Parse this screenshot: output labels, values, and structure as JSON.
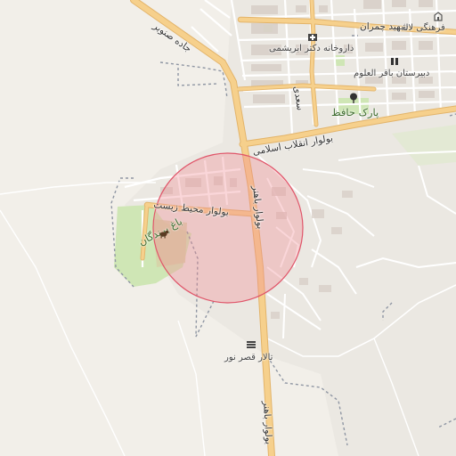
{
  "map": {
    "labels": {
      "jadeh_sanobar": "جاده صنوبر",
      "shahid_chamran": "شهید چمران",
      "farhangi_laleh": "فرهنگی لاله",
      "darukhaneh": "داروخانه دکتر ابریشمی",
      "dabirestan": "دبیرستان باقر العلوم",
      "park_hafez": "پارک حافظ",
      "saadi": "سعدی",
      "bolvar_enghelab": "بولوار انقلاب اسلامی",
      "bolvar_mohit": "بولوار محیط زیست",
      "bolvar_bahonar_1": "بولوار باهنر",
      "bolvar_bahonar_2": "بولوار باهنر",
      "bagh_parandegan": "باغ پرندگان",
      "talar": "تالار قصر نور"
    },
    "colors": {
      "background": "#f2efe9",
      "major_road": "#f6d08c",
      "major_road_casing": "#e3b46a",
      "minor_road": "#ffffff",
      "park": "#cfe6b5",
      "circle_fill": "#f08a93",
      "circle_stroke": "#e0566a",
      "boundary": "#8f96a3"
    },
    "icons": [
      "school-icon",
      "pharmacy-icon",
      "park-icon",
      "zoo-icon",
      "hall-icon",
      "building-icon"
    ]
  }
}
